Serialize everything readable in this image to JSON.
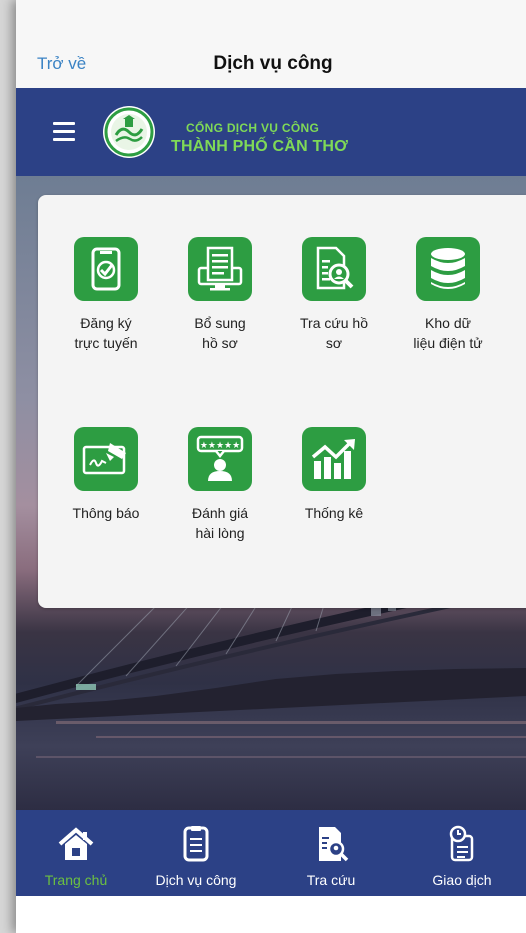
{
  "nav": {
    "back_label": "Trở về",
    "title": "Dịch vụ công"
  },
  "header": {
    "brand_line1": "CỔNG DỊCH VỤ CÔNG",
    "brand_line2": "THÀNH PHỐ CẦN THƠ"
  },
  "tiles": [
    {
      "label": "Đăng ký\ntrực tuyến",
      "icon": "online-register-icon"
    },
    {
      "label": "Bổ sung\nhồ sơ",
      "icon": "supplement-file-icon"
    },
    {
      "label": "Tra cứu hồ\nsơ",
      "icon": "file-search-icon"
    },
    {
      "label": "Kho dữ\nliệu điện tử",
      "icon": "database-icon"
    },
    {
      "label": "Thông báo",
      "icon": "notification-sign-icon"
    },
    {
      "label": "Đánh giá\nhài lòng",
      "icon": "rating-icon"
    },
    {
      "label": "Thống kê",
      "icon": "statistics-icon"
    }
  ],
  "tabs": [
    {
      "label": "Trang chủ",
      "icon": "home-icon",
      "active": true
    },
    {
      "label": "Dịch vụ công",
      "icon": "document-list-icon",
      "active": false
    },
    {
      "label": "Tra cứu",
      "icon": "file-search-icon",
      "active": false
    },
    {
      "label": "Giao dịch",
      "icon": "clipboard-clock-icon",
      "active": false
    }
  ],
  "colors": {
    "primary": "#2c4186",
    "accent_green": "#2d9d42",
    "active_tab": "#6cc041",
    "link": "#3b83c4"
  }
}
